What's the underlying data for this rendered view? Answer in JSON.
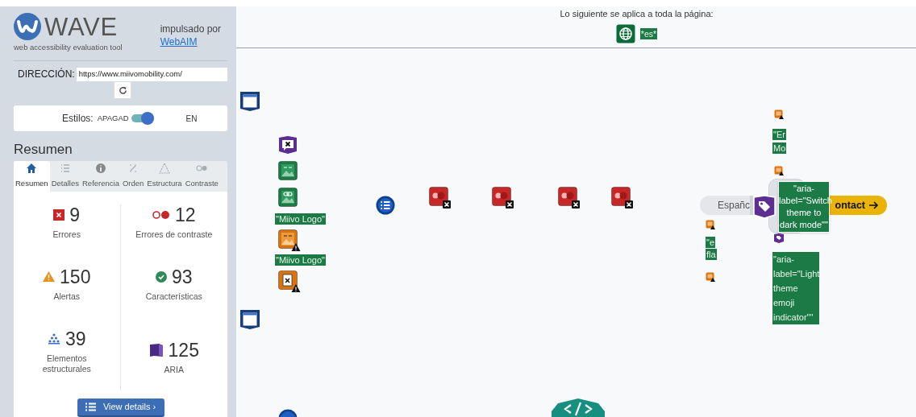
{
  "sidebar": {
    "logo": {
      "title": "WAVE",
      "subtitle": "web accessibility evaluation tool"
    },
    "powered_by": {
      "text": "impulsado por",
      "link": "WebAIM"
    },
    "address": {
      "label": "DIRECCIÓN:",
      "value": "https://www.miivomobility.com/"
    },
    "styles": {
      "label": "Estilos:",
      "off_label": "APAGAD",
      "on_label": "EN",
      "on": true
    },
    "summary_title": "Resumen",
    "tabs": [
      {
        "kind": "home",
        "label": "Resumen",
        "selected": true
      },
      {
        "kind": "list",
        "label": "Detalles",
        "selected": false
      },
      {
        "kind": "info",
        "label": "Referencia",
        "selected": false
      },
      {
        "kind": "order",
        "label": "Orden",
        "selected": false
      },
      {
        "kind": "structure",
        "label": "Estructura",
        "selected": false
      },
      {
        "kind": "contrast",
        "label": "Contraste",
        "selected": false
      }
    ],
    "stats": [
      {
        "kind": "error",
        "count": "9",
        "label": "Errores"
      },
      {
        "kind": "contrast",
        "count": "12",
        "label": "Errores de contraste"
      },
      {
        "kind": "alert",
        "count": "150",
        "label": "Alertas"
      },
      {
        "kind": "feature",
        "count": "93",
        "label": "Características"
      },
      {
        "kind": "structure",
        "count": "39",
        "label": "Elementos estructurales"
      },
      {
        "kind": "aria",
        "count": "125",
        "label": "ARIA"
      }
    ],
    "details_button": "View details ›"
  },
  "page_banner": {
    "text": "Lo siguiente se aplica a toda la página:",
    "language_tag": "*es*"
  },
  "canvas": {
    "items": [
      {
        "kind": "region"
      },
      {
        "kind": "aria-error"
      },
      {
        "kind": "image"
      },
      {
        "kind": "linked-image"
      },
      {
        "kind": "label",
        "text": "\"Miivo Logo\""
      },
      {
        "kind": "image-alert"
      },
      {
        "kind": "label",
        "text": "\"Miivo Logo\""
      },
      {
        "kind": "longdesc-alert"
      },
      {
        "kind": "region"
      },
      {
        "kind": "list"
      },
      {
        "kind": "contrast"
      },
      {
        "kind": "contrast"
      },
      {
        "kind": "contrast"
      },
      {
        "kind": "contrast"
      },
      {
        "kind": "small-alert"
      },
      {
        "kind": "label",
        "text": "\"Er"
      },
      {
        "kind": "label",
        "text": "Mo"
      },
      {
        "kind": "small-alert"
      },
      {
        "kind": "pill",
        "text": "Españc"
      },
      {
        "kind": "panel"
      },
      {
        "kind": "tag"
      },
      {
        "kind": "tooltip",
        "text": "\"aria-label=\"Switch theme to dark mode\"\""
      },
      {
        "kind": "cta",
        "text": "ontact"
      },
      {
        "kind": "small-alert"
      },
      {
        "kind": "label",
        "text": "\"e"
      },
      {
        "kind": "label",
        "text": "fla"
      },
      {
        "kind": "small-alert"
      },
      {
        "kind": "small-tag"
      },
      {
        "kind": "label-block",
        "text": "\"aria-label=\"Light theme emoji indicator\"\""
      },
      {
        "kind": "heading-circle"
      },
      {
        "kind": "code"
      }
    ]
  }
}
